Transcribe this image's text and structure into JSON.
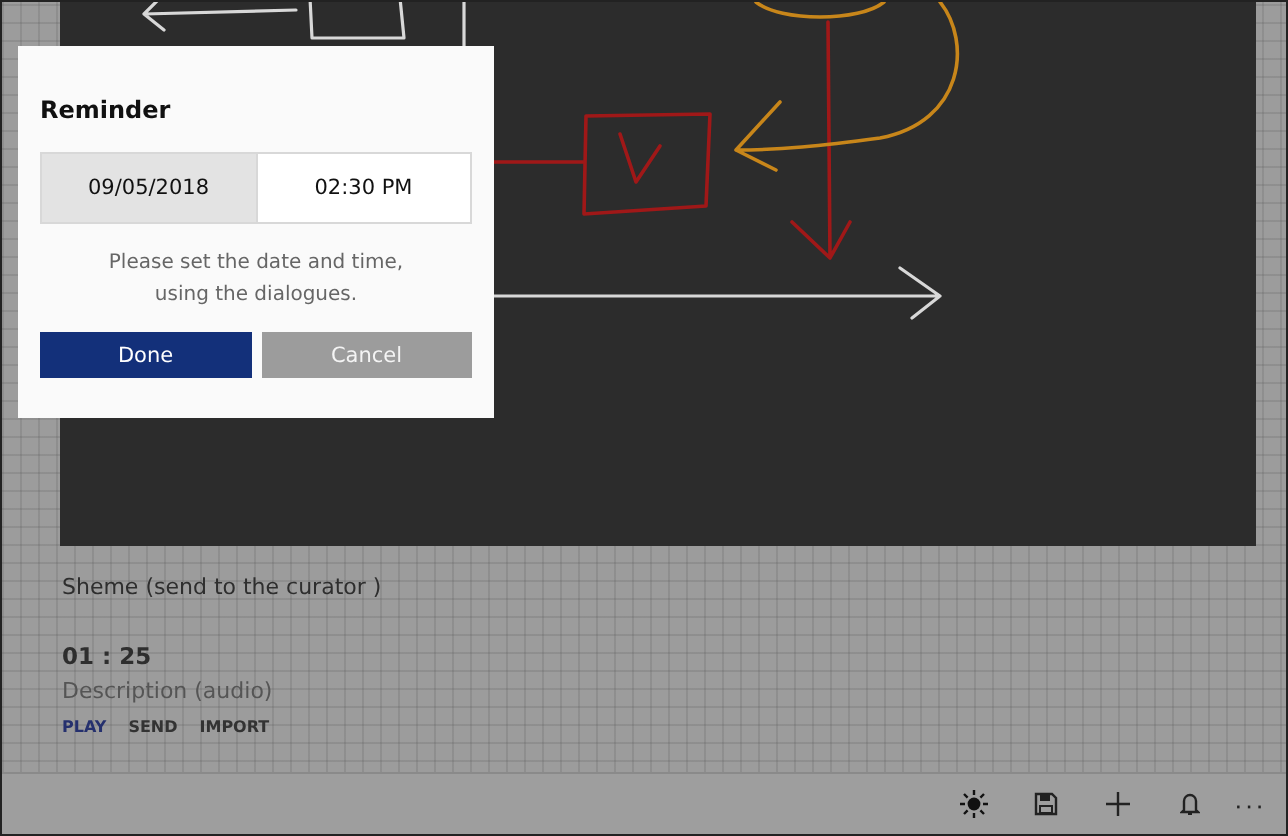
{
  "dialog": {
    "title": "Reminder",
    "pickers": [
      {
        "value": "09/05/2018",
        "selected": true
      },
      {
        "value": "02:30 PM",
        "selected": false
      }
    ],
    "message": "Please set the date and time, using the dialogues.",
    "buttons": [
      {
        "label": "Done",
        "kind": "primary"
      },
      {
        "label": "Cancel",
        "kind": "secondary"
      }
    ]
  },
  "note": {
    "title": "Sheme (send to the curator )",
    "duration": "01 : 25",
    "description": "Description (audio)",
    "actions": [
      {
        "label": "PLAY",
        "selected": true
      },
      {
        "label": "SEND",
        "selected": false
      },
      {
        "label": "IMPORT",
        "selected": false
      }
    ]
  },
  "app_bar": {
    "items": [
      {
        "kind": "brightness"
      },
      {
        "kind": "save"
      },
      {
        "kind": "add"
      },
      {
        "kind": "bell"
      },
      {
        "kind": "more",
        "label": "···"
      }
    ]
  }
}
